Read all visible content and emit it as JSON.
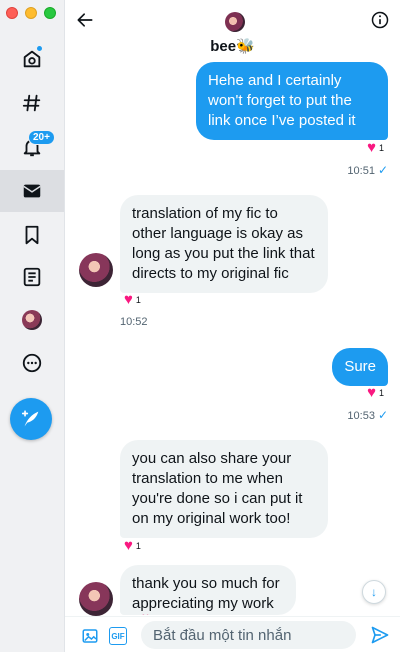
{
  "window": {
    "controls": [
      "close",
      "minimize",
      "zoom"
    ]
  },
  "sidebar": {
    "notifications_badge": "20+",
    "items": [
      {
        "name": "home",
        "icon": "home-icon"
      },
      {
        "name": "explore",
        "icon": "hashtag-icon"
      },
      {
        "name": "notifications",
        "icon": "bell-icon"
      },
      {
        "name": "messages",
        "icon": "envelope-icon",
        "active": true
      },
      {
        "name": "bookmarks",
        "icon": "bookmark-icon"
      },
      {
        "name": "lists",
        "icon": "list-icon"
      },
      {
        "name": "profile",
        "icon": "avatar-icon"
      },
      {
        "name": "more",
        "icon": "more-icon"
      }
    ],
    "compose_icon": "compose-feather-icon"
  },
  "header": {
    "name": "bee🐝",
    "back_icon": "back-arrow-icon",
    "info_icon": "info-icon"
  },
  "messages": [
    {
      "dir": "sent",
      "text": "Hehe and I certainly won't forget to put the link once I’ve posted it",
      "reaction_count": "1",
      "time": "10:51",
      "check": "✓"
    },
    {
      "dir": "received",
      "text": "translation of my fic to other language is okay as long as you put the link that directs to my original fic",
      "reaction_count": "1",
      "time": "10:52"
    },
    {
      "dir": "sent",
      "text": "Sure",
      "reaction_count": "1",
      "time": "10:53",
      "check": "✓"
    },
    {
      "dir": "received",
      "text": "you can also share your translation to me when you're done so i can put it on my original work too!",
      "reaction_count": "1"
    },
    {
      "dir": "received",
      "text": "thank you so much for appreciating my work 💞"
    }
  ],
  "composer": {
    "placeholder": "Bắt đầu một tin nhắn",
    "gif_label": "GIF"
  },
  "colors": {
    "accent": "#1d9bf0",
    "heart": "#f91880",
    "received_bg": "#eff3f4"
  }
}
